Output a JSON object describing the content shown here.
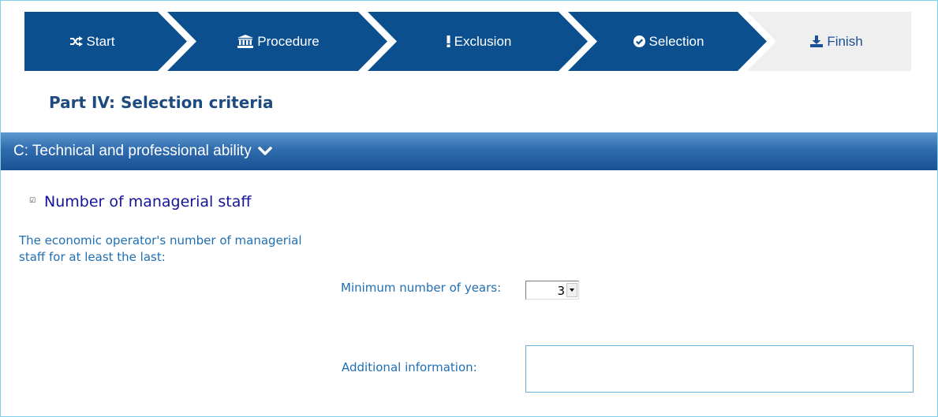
{
  "stepper": {
    "steps": [
      {
        "label": "Start",
        "icon": "random-icon",
        "active": true
      },
      {
        "label": "Procedure",
        "icon": "institution-icon",
        "active": true
      },
      {
        "label": "Exclusion",
        "icon": "exclamation-icon",
        "active": true
      },
      {
        "label": "Selection",
        "icon": "check-circle-icon",
        "active": true
      },
      {
        "label": "Finish",
        "icon": "download-icon",
        "active": false
      }
    ],
    "colors": {
      "active": "#0b4f8f",
      "inactive": "#efefef",
      "inactive_text": "#1d4f96"
    }
  },
  "page": {
    "title": "Part IV: Selection criteria"
  },
  "section": {
    "title": "C: Technical and professional ability",
    "icon": "chevron-down-icon"
  },
  "criterion": {
    "checkbox_glyph": "☑",
    "title": "Number of managerial staff",
    "description": "The economic operator's number of managerial staff for at least the last:"
  },
  "fields": {
    "years": {
      "label": "Minimum number of years:",
      "value": "3"
    },
    "additional_info": {
      "label": "Additional information:",
      "value": "",
      "placeholder": ""
    }
  }
}
